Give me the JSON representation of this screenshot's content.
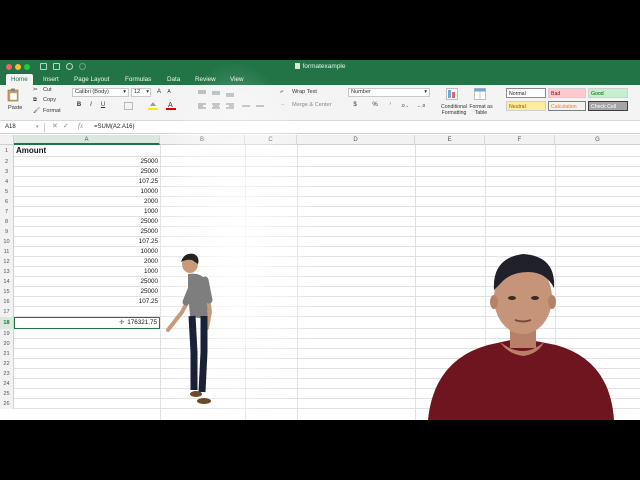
{
  "window": {
    "title": "formatexample",
    "title_bar_color": "#227447"
  },
  "tabs": [
    {
      "label": "Home",
      "active": true
    },
    {
      "label": "Insert"
    },
    {
      "label": "Page Layout"
    },
    {
      "label": "Formulas"
    },
    {
      "label": "Data"
    },
    {
      "label": "Review"
    },
    {
      "label": "View"
    }
  ],
  "ribbon": {
    "paste_label": "Paste",
    "cut_label": "Cut",
    "copy_label": "Copy",
    "format_label": "Format",
    "font_name": "Calibri (Body)",
    "font_size": "12",
    "wrap_text_label": "Wrap Text",
    "merge_center_label": "Merge & Center",
    "number_format": "Number",
    "conditional_formatting_label": "Conditional Formatting",
    "format_as_table_label": "Format as Table",
    "styles": {
      "normal": "Normal",
      "bad": "Bad",
      "good": "Good",
      "neutral": "Neutral",
      "calculation": "Calculation",
      "check_cell": "Check Cell"
    }
  },
  "formula_bar": {
    "name_box": "A18",
    "fx": "fx",
    "formula": "=SUM(A2:A16)"
  },
  "columns": [
    "A",
    "B",
    "C",
    "D",
    "E",
    "F",
    "G"
  ],
  "selected_column": "A",
  "sheet": {
    "header_label": "Amount",
    "rows": [
      {
        "row": "1",
        "value": "Amount"
      },
      {
        "row": "2",
        "value": "25000"
      },
      {
        "row": "3",
        "value": "25000"
      },
      {
        "row": "4",
        "value": "107.25"
      },
      {
        "row": "5",
        "value": "10000"
      },
      {
        "row": "6",
        "value": "2000"
      },
      {
        "row": "7",
        "value": "1000"
      },
      {
        "row": "8",
        "value": "25000"
      },
      {
        "row": "9",
        "value": "25000"
      },
      {
        "row": "10",
        "value": "107.25"
      },
      {
        "row": "11",
        "value": "10000"
      },
      {
        "row": "12",
        "value": "2000"
      },
      {
        "row": "13",
        "value": "1000"
      },
      {
        "row": "14",
        "value": "25000"
      },
      {
        "row": "15",
        "value": "25000"
      },
      {
        "row": "16",
        "value": "107.25"
      },
      {
        "row": "17",
        "value": ""
      },
      {
        "row": "18",
        "value": "176321.75",
        "selected": true
      },
      {
        "row": "19",
        "value": ""
      },
      {
        "row": "20",
        "value": ""
      },
      {
        "row": "21",
        "value": ""
      },
      {
        "row": "22",
        "value": ""
      },
      {
        "row": "23",
        "value": ""
      },
      {
        "row": "24",
        "value": ""
      },
      {
        "row": "25",
        "value": ""
      },
      {
        "row": "26",
        "value": ""
      }
    ]
  },
  "icons": [
    "paste-icon",
    "scissors-icon",
    "copy-icon",
    "format-painter-icon",
    "bold-icon",
    "italic-icon",
    "underline-icon",
    "borders-icon",
    "fill-color-icon",
    "font-color-icon",
    "align-icon",
    "wrap-text-icon",
    "merge-icon",
    "currency-icon",
    "percent-icon",
    "conditional-formatting-icon",
    "format-as-table-icon",
    "cross-cursor-icon"
  ]
}
